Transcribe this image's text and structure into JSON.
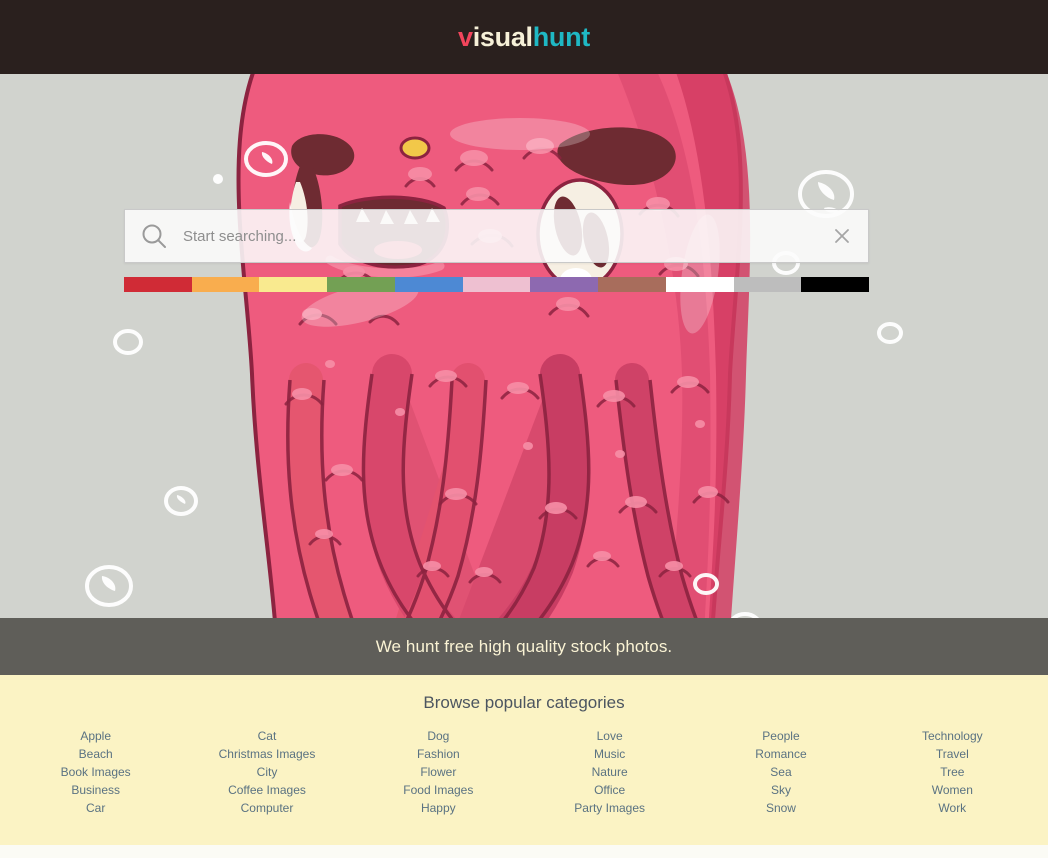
{
  "header": {
    "logo_part1": "v",
    "logo_part2": "isual",
    "logo_part3": "hunt",
    "logo_color1": "#f2455c",
    "logo_color2": "#f6f0d8",
    "logo_color3": "#1fb8c4",
    "background": "#2a201e"
  },
  "search": {
    "placeholder": "Start searching...",
    "value": "",
    "search_icon": "magnifier-icon",
    "clear_icon": "close-x-icon"
  },
  "swatches": [
    {
      "name": "red",
      "color": "#d02b36"
    },
    {
      "name": "orange",
      "color": "#f9ad4e"
    },
    {
      "name": "yellow",
      "color": "#f9ea8f"
    },
    {
      "name": "green",
      "color": "#73a054"
    },
    {
      "name": "blue",
      "color": "#4d89d4"
    },
    {
      "name": "pink",
      "color": "#eec0d1"
    },
    {
      "name": "purple",
      "color": "#8d69b0"
    },
    {
      "name": "brown",
      "color": "#a86d5c"
    },
    {
      "name": "white",
      "color": "#ffffff"
    },
    {
      "name": "gray",
      "color": "#bdbdbd"
    },
    {
      "name": "black",
      "color": "#000000"
    }
  ],
  "tagline": {
    "text": "We hunt free high quality stock photos.",
    "background": "#4e4d4a",
    "color": "#faf3d4"
  },
  "categories": {
    "heading": "Browse popular categories",
    "background": "#fbf3c4",
    "link_color": "#5a7282",
    "columns": [
      [
        "Apple",
        "Beach",
        "Book Images",
        "Business",
        "Car"
      ],
      [
        "Cat",
        "Christmas Images",
        "City",
        "Coffee Images",
        "Computer"
      ],
      [
        "Dog",
        "Fashion",
        "Flower",
        "Food Images",
        "Happy"
      ],
      [
        "Love",
        "Music",
        "Nature",
        "Office",
        "Party Images"
      ],
      [
        "People",
        "Romance",
        "Sea",
        "Sky",
        "Snow"
      ],
      [
        "Technology",
        "Travel",
        "Tree",
        "Women",
        "Work"
      ]
    ]
  },
  "hero": {
    "background": "#d1d3ce",
    "illustration": "pink-monster-illustration",
    "body_color": "#ee5b7e",
    "body_shadow": "#d94468",
    "outline_color": "#8c2340",
    "dark_blob_color": "#6e2b32",
    "highlight_color": "#f78fa7",
    "eye_white": "#f6efe3",
    "bubble_color": "#ffffff"
  }
}
